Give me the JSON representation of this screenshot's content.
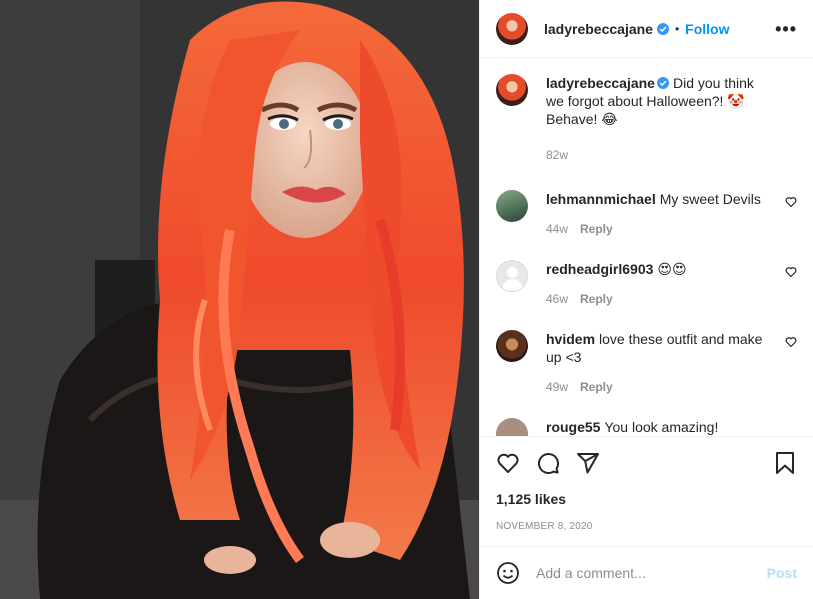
{
  "post": {
    "username": "ladyrebeccajane",
    "follow_label": "Follow",
    "separator": "•",
    "more_label": "•••",
    "caption": {
      "username": "ladyrebeccajane",
      "text": "Did you think we forgot about Halloween?! 🤡 Behave! 😂",
      "time": "82w"
    },
    "comments": [
      {
        "username": "lehmannmichael",
        "text": "My sweet Devils",
        "time": "44w",
        "reply": "Reply"
      },
      {
        "username": "redheadgirl6903",
        "text": "😍😍",
        "time": "46w",
        "reply": "Reply"
      },
      {
        "username": "hvidem",
        "text": "love these outfit and make up <3",
        "time": "49w",
        "reply": "Reply"
      },
      {
        "username": "rouge55",
        "text": "You look amazing!",
        "time": "",
        "reply": ""
      }
    ],
    "likes": "1,125 likes",
    "date": "NOVEMBER 8, 2020",
    "comment_placeholder": "Add a comment...",
    "post_label": "Post"
  },
  "colors": {
    "accent": "#0095f6",
    "verified": "#3897f0",
    "post_disabled": "#b2dffc",
    "secondary_text": "#8e8e8e",
    "hair": "#f2552f"
  },
  "icons": {
    "verified": "verified-badge-icon",
    "heart": "heart-icon",
    "comment": "comment-icon",
    "share": "share-icon",
    "save": "bookmark-icon",
    "emoji": "emoji-icon",
    "more": "more-options-icon"
  }
}
